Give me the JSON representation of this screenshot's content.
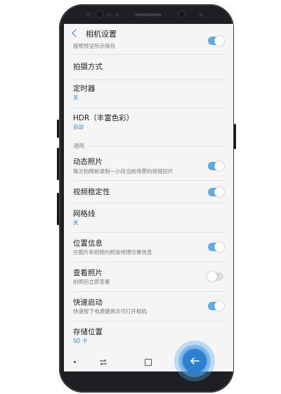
{
  "header": {
    "title": "相机设置",
    "back_icon": "chevron-left-icon"
  },
  "items": [
    {
      "title": "",
      "subtitle": "按照预览所示保存",
      "toggle": "on"
    },
    {
      "title": "拍摄方式"
    },
    {
      "title": "定时器",
      "value": "关"
    },
    {
      "title": "HDR（丰富色彩）",
      "value": "自动"
    },
    {
      "title": "动态照片",
      "subtitle": "每次拍照前录制一小段当前场景的视频短片",
      "toggle": "on"
    },
    {
      "title": "视频稳定性",
      "toggle": "on"
    },
    {
      "title": "网格线",
      "value": "关"
    },
    {
      "title": "位置信息",
      "subtitle": "在图片和视频内附加地理位置信息",
      "toggle": "on"
    },
    {
      "title": "查看照片",
      "subtitle": "拍照后立即查看",
      "toggle": "off"
    },
    {
      "title": "快速启动",
      "subtitle": "快速按下电源键两次可打开相机",
      "toggle": "on"
    },
    {
      "title": "存储位置",
      "value": "SD 卡"
    }
  ],
  "section": {
    "label": "通用"
  },
  "navbar": {
    "buttons": [
      "dot-icon",
      "recent-apps-icon",
      "home-icon",
      "back-arrow-icon"
    ]
  },
  "colors": {
    "accent": "#2b83d3",
    "toggle_on": "#5dade6",
    "toggle_off": "#dcdcdc"
  }
}
